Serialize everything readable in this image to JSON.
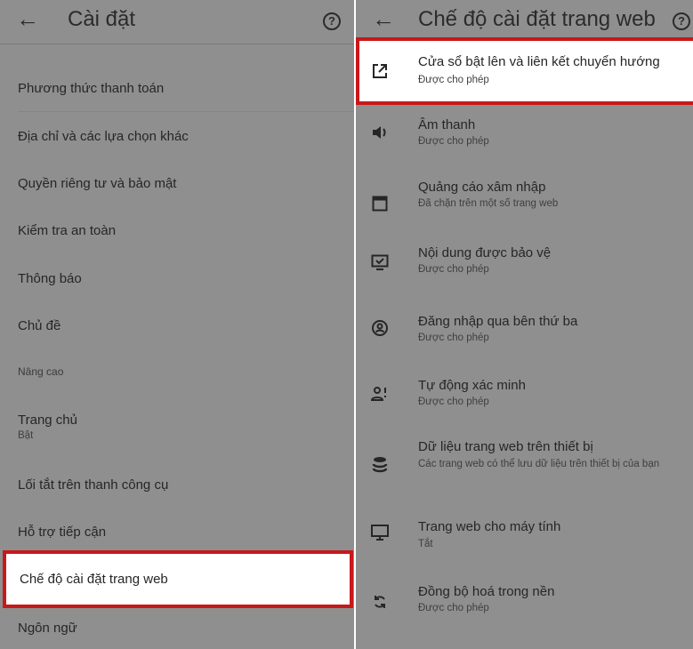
{
  "left": {
    "back_icon": "arrow-left",
    "title": "Cài đặt",
    "help_icon": "help-circle",
    "items": [
      {
        "label": "Phương thức thanh toán"
      },
      {
        "label": "Địa chỉ và các lựa chọn khác"
      },
      {
        "label": "Quyền riêng tư và bảo mật"
      },
      {
        "label": "Kiểm tra an toàn"
      },
      {
        "label": "Thông báo"
      },
      {
        "label": "Chủ đề"
      }
    ],
    "section_advanced": "Nâng cao",
    "homepage": {
      "label": "Trang chủ",
      "sub": "Bật"
    },
    "items2": [
      {
        "label": "Lối tắt trên thanh công cụ"
      },
      {
        "label": "Hỗ trợ tiếp cận"
      },
      {
        "label": "Chế độ cài đặt trang web"
      },
      {
        "label": "Ngôn ngữ"
      }
    ],
    "highlighted": "Chế độ cài đặt trang web"
  },
  "right": {
    "back_icon": "arrow-left",
    "title": "Chế độ cài đặt trang web",
    "help_icon": "help-circle",
    "items": [
      {
        "icon": "open-in-new-icon",
        "title": "Cửa sổ bật lên và liên kết chuyển hướng",
        "sub": "Được cho phép"
      },
      {
        "icon": "speaker-icon",
        "title": "Âm thanh",
        "sub": "Được cho phép"
      },
      {
        "icon": "ad-window-icon",
        "title": "Quảng cáo xâm nhập",
        "sub": "Đã chặn trên một số trang web"
      },
      {
        "icon": "protected-content-icon",
        "title": "Nội dung được bảo vệ",
        "sub": "Được cho phép"
      },
      {
        "icon": "account-circle-icon",
        "title": "Đăng nhập qua bên thứ ba",
        "sub": "Được cho phép"
      },
      {
        "icon": "person-verify-icon",
        "title": "Tự động xác minh",
        "sub": "Được cho phép"
      },
      {
        "icon": "database-icon",
        "title": "Dữ liệu trang web trên thiết bị",
        "sub": "Các trang web có thể lưu dữ liệu trên thiết bị của bạn"
      },
      {
        "icon": "desktop-icon",
        "title": "Trang web cho máy tính",
        "sub": "Tắt"
      },
      {
        "icon": "sync-icon",
        "title": "Đồng bộ hoá trong nền",
        "sub": "Được cho phép"
      }
    ]
  },
  "colors": {
    "panel": "#8f8f8f",
    "highlight_border": "#c8181b",
    "highlight_bg": "#ffffff"
  }
}
